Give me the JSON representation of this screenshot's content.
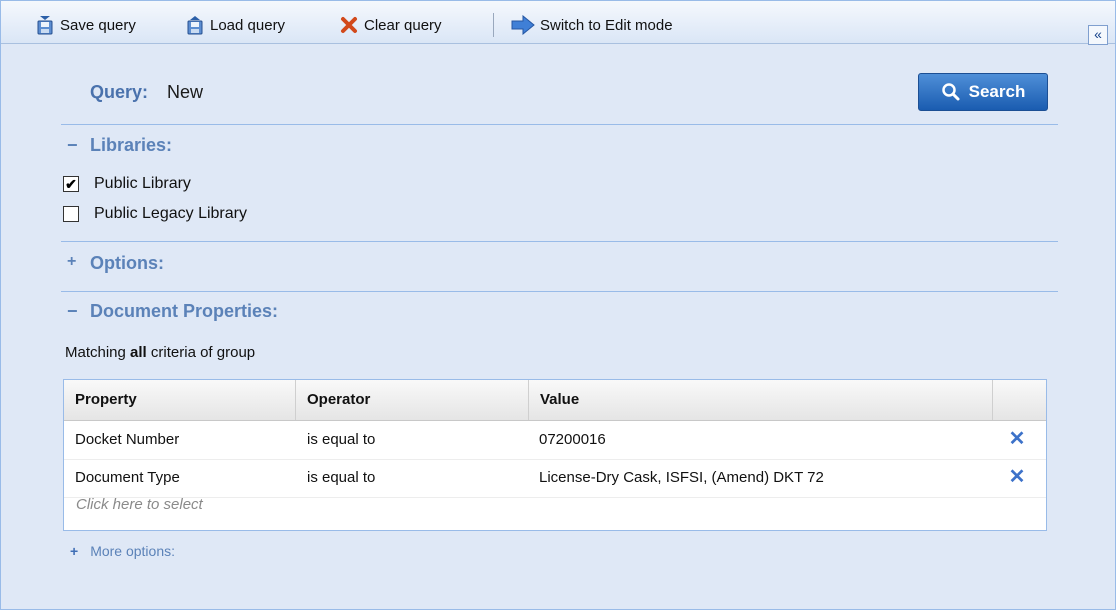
{
  "toolbar": {
    "save_label": "Save query",
    "load_label": "Load query",
    "clear_label": "Clear query",
    "switch_label": "Switch to Edit mode",
    "collapse_glyph": "«"
  },
  "query": {
    "label": "Query:",
    "value": "New"
  },
  "search_button": {
    "label": "Search"
  },
  "libraries": {
    "toggle": "−",
    "title": "Libraries:",
    "items": [
      {
        "label": "Public Library",
        "checked": true
      },
      {
        "label": "Public Legacy Library",
        "checked": false
      }
    ]
  },
  "options": {
    "toggle": "+",
    "title": "Options:"
  },
  "document_properties": {
    "toggle": "−",
    "title": "Document Properties:",
    "matching_prefix": "Matching",
    "matching_bold": "all",
    "matching_suffix": "criteria of group",
    "columns": [
      "Property",
      "Operator",
      "Value"
    ],
    "rows": [
      {
        "property": "Docket Number",
        "operator": "is equal to",
        "value": "07200016"
      },
      {
        "property": "Document Type",
        "operator": "is equal to",
        "value": "License-Dry Cask, ISFSI, (Amend) DKT 72"
      }
    ],
    "placeholder": "Click here to select"
  },
  "more_options": {
    "toggle": "+",
    "label": "More options:"
  },
  "colors": {
    "panel_bg": "#dfe8f6",
    "heading": "#5b82b8",
    "search_btn": "#1a5cb0",
    "delete_x": "#3d72c9"
  },
  "icons": {
    "save": "save-icon",
    "load": "load-icon",
    "clear": "clear-x-icon",
    "switch": "arrow-right-icon",
    "search": "magnifier-icon",
    "delete": "delete-x-icon",
    "collapse": "double-chevron-left-icon"
  }
}
